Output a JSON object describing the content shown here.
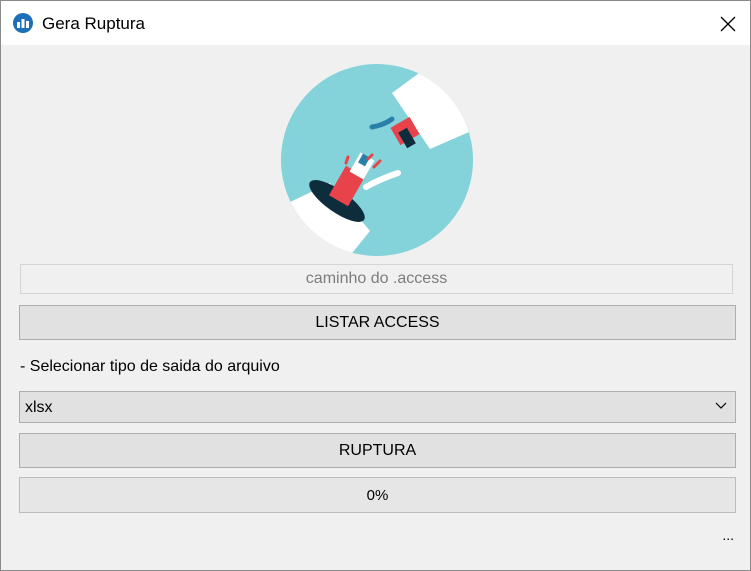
{
  "window": {
    "title": "Gera Ruptura",
    "app_icon": "app-logo-icon",
    "close_icon": "close-icon"
  },
  "path_input": {
    "value": "",
    "placeholder": "caminho do .access"
  },
  "buttons": {
    "listar_label": "LISTAR ACCESS",
    "ruptura_label": "RUPTURA"
  },
  "output_type": {
    "label": "- Selecionar tipo de saida do arquivo",
    "selected": "xlsx"
  },
  "progress": {
    "value": 0,
    "text": "0%"
  },
  "status": {
    "text": "..."
  },
  "colors": {
    "illustration_bg": "#84d2da",
    "accent_red": "#e8424a",
    "accent_blue": "#2a7fa8",
    "dark": "#0d2d3c",
    "titlebar": "#ffffff",
    "window_bg": "#f0f0f0"
  }
}
